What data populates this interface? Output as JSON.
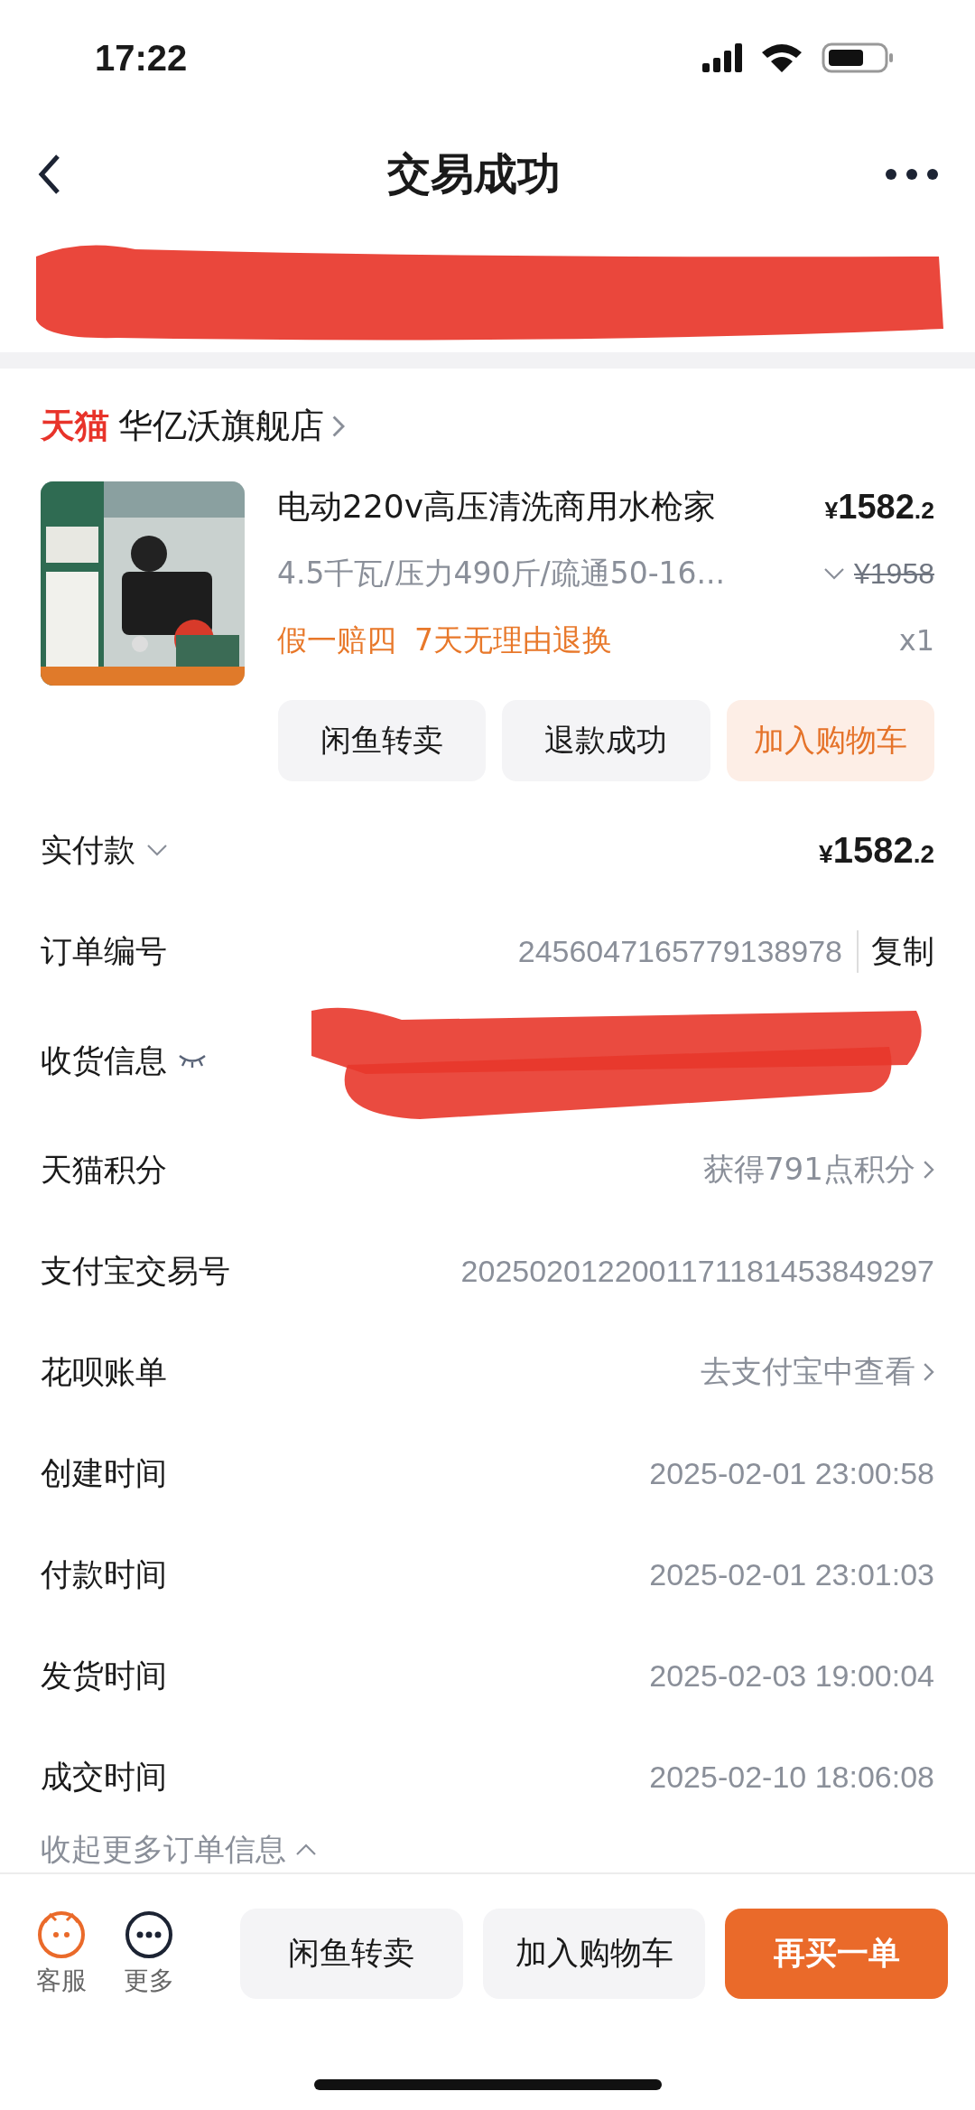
{
  "status_bar": {
    "time": "17:22"
  },
  "header": {
    "title": "交易成功"
  },
  "store": {
    "badge": "天猫",
    "name": "华亿沃旗舰店"
  },
  "product": {
    "image": {
      "kind": "picture"
    },
    "title": "电动220v高压清洗商用水枪家",
    "price": {
      "currency": "¥",
      "integer": "1582",
      "decimal": ".2"
    },
    "spec": "4.5千瓦/压力490斤/疏通50-16...",
    "original_price": "¥1958",
    "tags": [
      "假一赔四",
      "7天无理由退换"
    ],
    "quantity": "x1",
    "actions": [
      {
        "label": "闲鱼转卖",
        "kind": "plain"
      },
      {
        "label": "退款成功",
        "kind": "plain"
      },
      {
        "label": "加入购物车",
        "kind": "accent"
      }
    ]
  },
  "paid": {
    "label": "实付款",
    "price": {
      "currency": "¥",
      "integer": "1582",
      "decimal": ".2"
    }
  },
  "rows": [
    {
      "label": "订单编号",
      "value": "2456047165779138978",
      "kind": "copy",
      "action": "复制"
    },
    {
      "label": "收货信息",
      "kind": "address"
    },
    {
      "label": "天猫积分",
      "value": "获得791点积分",
      "kind": "link"
    },
    {
      "label": "支付宝交易号",
      "value": "2025020122001171181453849297",
      "kind": "text"
    },
    {
      "label": "花呗账单",
      "value": "去支付宝中查看",
      "kind": "link"
    },
    {
      "label": "创建时间",
      "value": "2025-02-01 23:00:58",
      "kind": "text"
    },
    {
      "label": "付款时间",
      "value": "2025-02-01 23:01:03",
      "kind": "text"
    },
    {
      "label": "发货时间",
      "value": "2025-02-03 19:00:04",
      "kind": "text"
    },
    {
      "label": "成交时间",
      "value": "2025-02-10 18:06:08",
      "kind": "text"
    }
  ],
  "collapse_link": "收起更多订单信息",
  "bottom_bar": {
    "icons": [
      {
        "label": "客服",
        "kind": "service"
      },
      {
        "label": "更多",
        "kind": "more"
      }
    ],
    "buttons": [
      {
        "label": "闲鱼转卖",
        "kind": "plain"
      },
      {
        "label": "加入购物车",
        "kind": "plain"
      },
      {
        "label": "再买一单",
        "kind": "primary"
      }
    ]
  }
}
